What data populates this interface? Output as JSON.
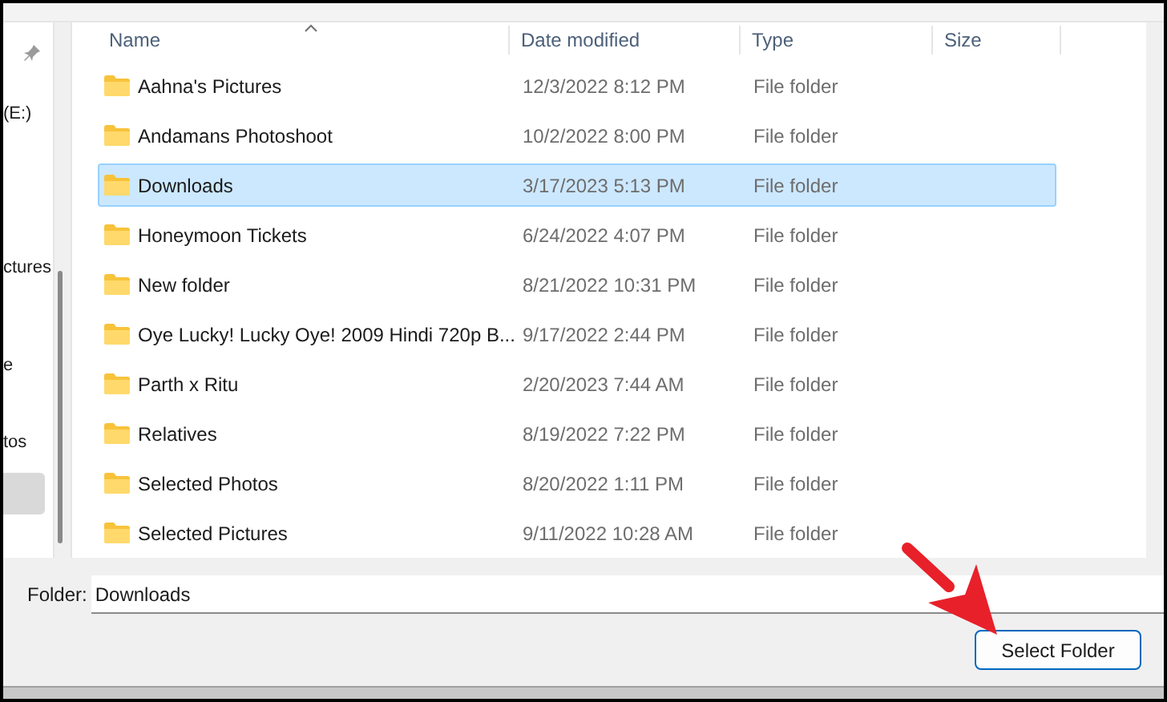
{
  "sidebar": {
    "items": [
      {
        "label": "(E:)",
        "selected": false
      },
      {
        "label": "ctures",
        "selected": false
      },
      {
        "label": "e",
        "selected": false
      },
      {
        "label": "tos",
        "selected": false
      },
      {
        "selected": true
      }
    ]
  },
  "table": {
    "columns": [
      "Name",
      "Date modified",
      "Type",
      "Size"
    ],
    "rows": [
      {
        "name": "Aahna's Pictures",
        "date": "12/3/2022 8:12 PM",
        "type": "File folder",
        "selected": false
      },
      {
        "name": "Andamans Photoshoot",
        "date": "10/2/2022 8:00 PM",
        "type": "File folder",
        "selected": false
      },
      {
        "name": "Downloads",
        "date": "3/17/2023 5:13 PM",
        "type": "File folder",
        "selected": true
      },
      {
        "name": "Honeymoon Tickets",
        "date": "6/24/2022 4:07 PM",
        "type": "File folder",
        "selected": false
      },
      {
        "name": "New folder",
        "date": "8/21/2022 10:31 PM",
        "type": "File folder",
        "selected": false
      },
      {
        "name": "Oye Lucky! Lucky Oye! 2009 Hindi 720p B...",
        "date": "9/17/2022 2:44 PM",
        "type": "File folder",
        "selected": false
      },
      {
        "name": "Parth x Ritu",
        "date": "2/20/2023 7:44 AM",
        "type": "File folder",
        "selected": false
      },
      {
        "name": "Relatives",
        "date": "8/19/2022 7:22 PM",
        "type": "File folder",
        "selected": false
      },
      {
        "name": "Selected Photos",
        "date": "8/20/2022 1:11 PM",
        "type": "File folder",
        "selected": false
      },
      {
        "name": "Selected Pictures",
        "date": "9/11/2022 10:28 AM",
        "type": "File folder",
        "selected": false
      }
    ]
  },
  "folder_field": {
    "label": "Folder:",
    "value": "Downloads"
  },
  "buttons": [
    "Select Folder"
  ]
}
